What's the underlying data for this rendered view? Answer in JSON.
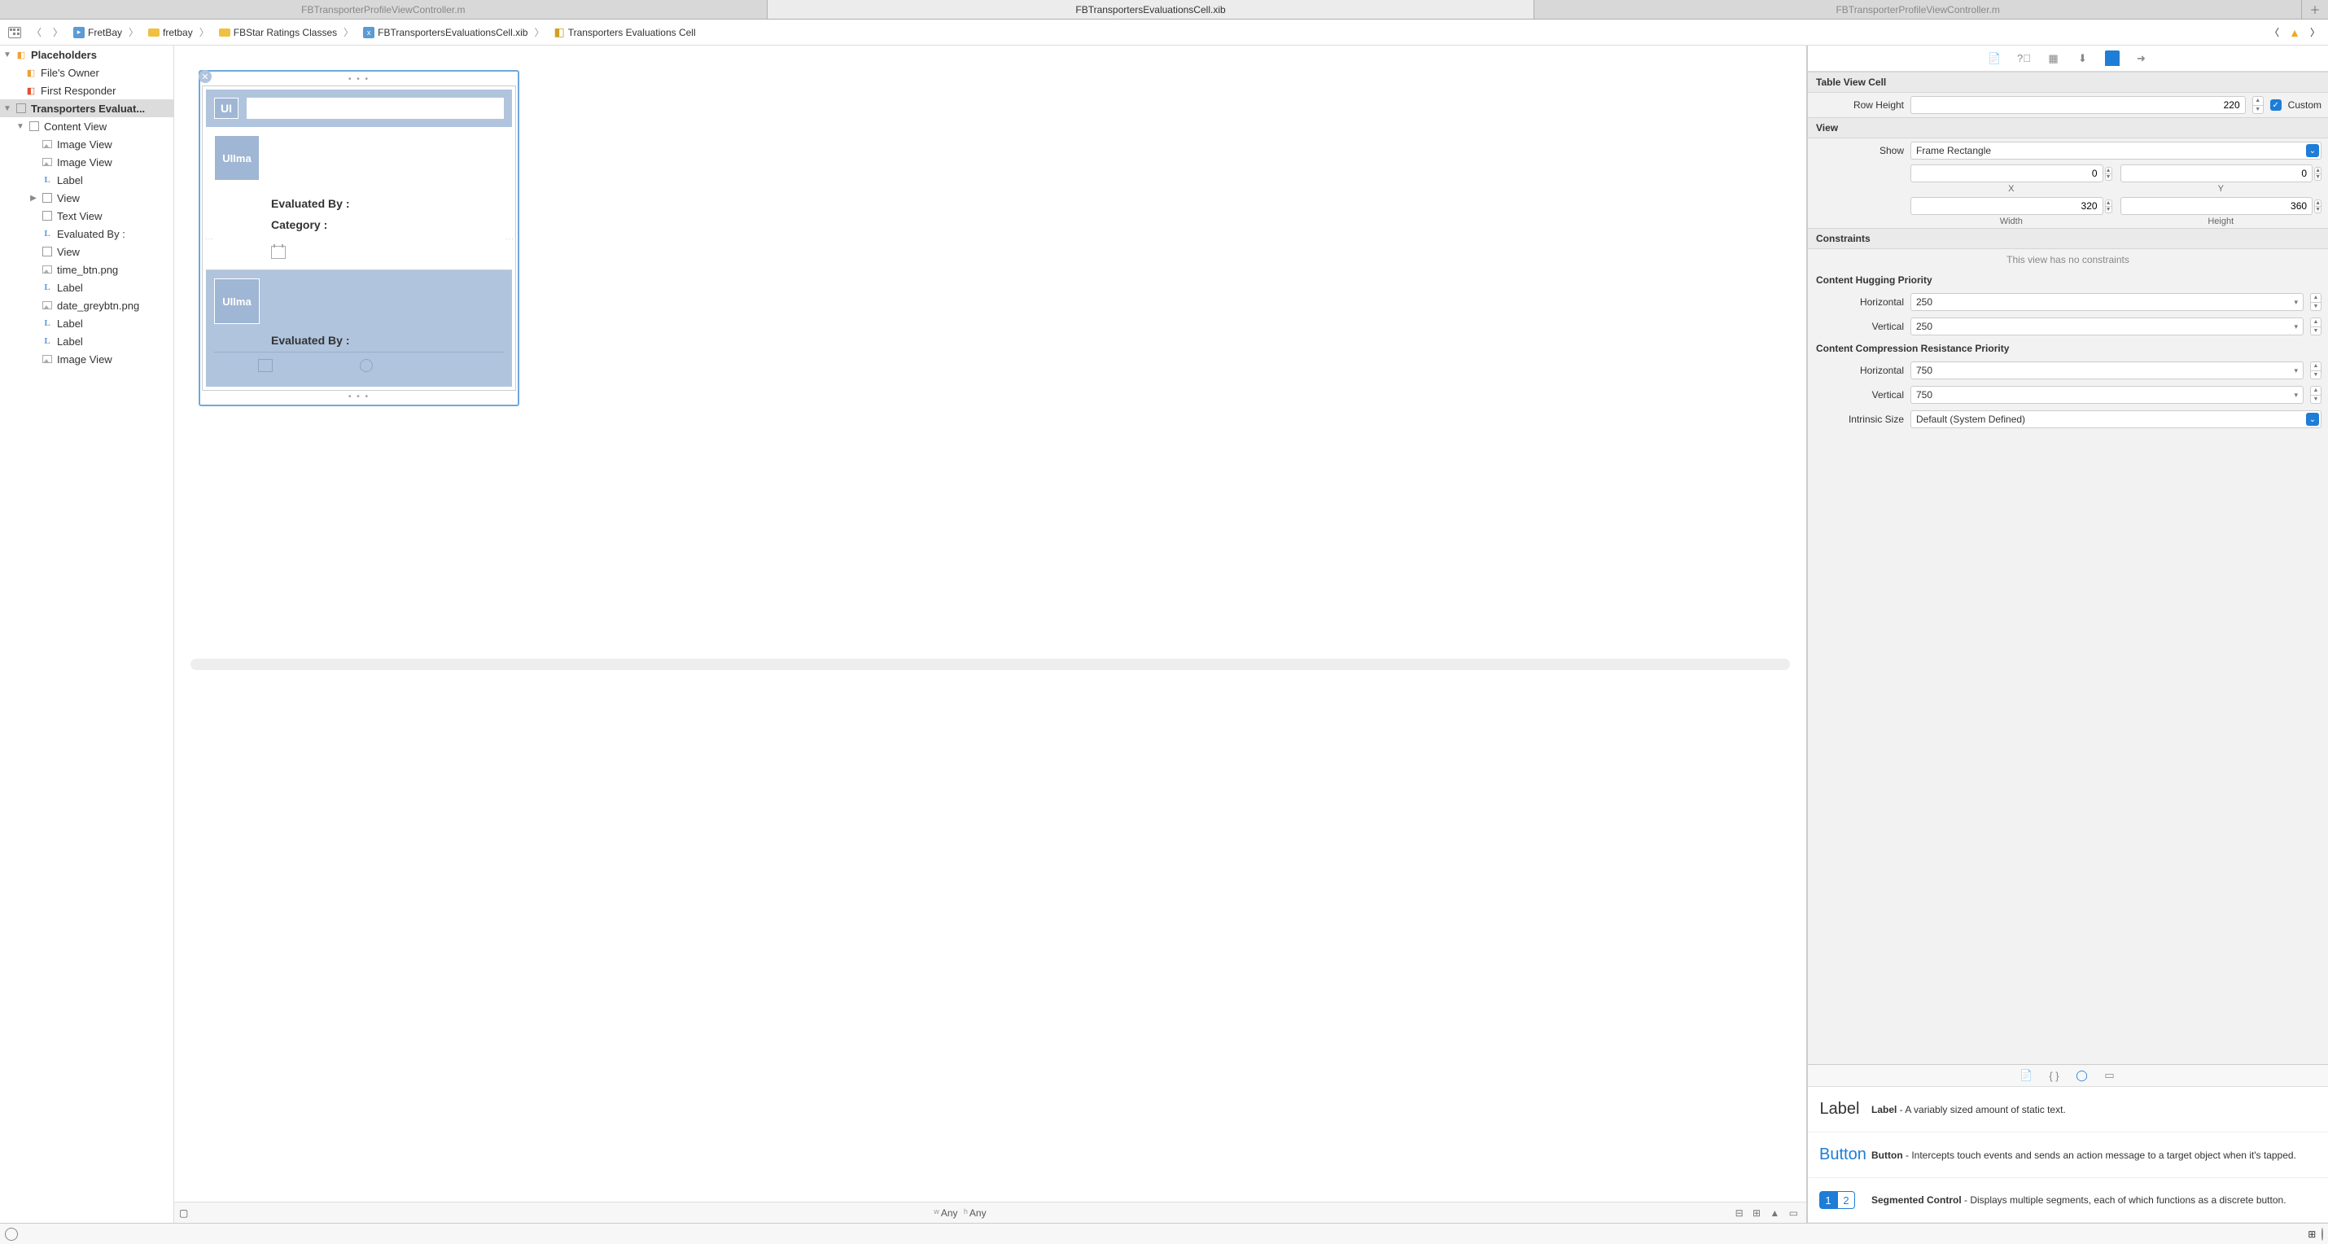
{
  "tabs": {
    "left": "FBTransporterProfileViewController.m",
    "center": "FBTransportersEvaluationsCell.xib",
    "right": "FBTransporterProfileViewController.m"
  },
  "breadcrumb": {
    "items": [
      "FretBay",
      "fretbay",
      "FBStar Ratings Classes",
      "FBTransportersEvaluationsCell.xib",
      "Transporters Evaluations Cell"
    ]
  },
  "outline": {
    "placeholders_h": "Placeholders",
    "files_owner": "File's Owner",
    "first_responder": "First Responder",
    "root": "Transporters Evaluat...",
    "content_view": "Content View",
    "items": [
      "Image View",
      "Image View",
      "Label",
      "View",
      "Text View",
      "Evaluated By :",
      "View",
      "time_btn.png",
      "Label",
      "date_greybtn.png",
      "Label",
      "Label",
      "Image View"
    ]
  },
  "canvas": {
    "ui": "UI",
    "ullma": "UIIma",
    "eval_by": "Evaluated By :",
    "category": "Category :",
    "eval_by2": "Evaluated By :",
    "sizeclass_w": "w",
    "sizeclass_any": "Any",
    "sizeclass_h": "h"
  },
  "inspector": {
    "s_tvc": "Table View Cell",
    "row_height_lbl": "Row Height",
    "row_height": "220",
    "custom": "Custom",
    "s_view": "View",
    "show_lbl": "Show",
    "show_val": "Frame Rectangle",
    "x": "0",
    "y": "0",
    "w": "320",
    "h": "360",
    "x_c": "X",
    "y_c": "Y",
    "w_c": "Width",
    "h_c": "Height",
    "s_constraints": "Constraints",
    "no_constraints": "This view has no constraints",
    "s_chp": "Content Hugging Priority",
    "horizontal": "Horizontal",
    "vertical": "Vertical",
    "chp_h": "250",
    "chp_v": "250",
    "s_ccrp": "Content Compression Resistance Priority",
    "ccrp_h": "750",
    "ccrp_v": "750",
    "intrinsic_lbl": "Intrinsic Size",
    "intrinsic_val": "Default (System Defined)"
  },
  "library": {
    "label_t": "Label",
    "label_b": "Label",
    "label_d": " - A variably sized amount of static text.",
    "button_t": "Button",
    "button_b": "Button",
    "button_d": " - Intercepts touch events and sends an action message to a target object when it's tapped.",
    "seg_b": "Segmented Control",
    "seg_d": " - Displays multiple segments, each of which functions as a discrete button.",
    "seg1": "1",
    "seg2": "2"
  }
}
